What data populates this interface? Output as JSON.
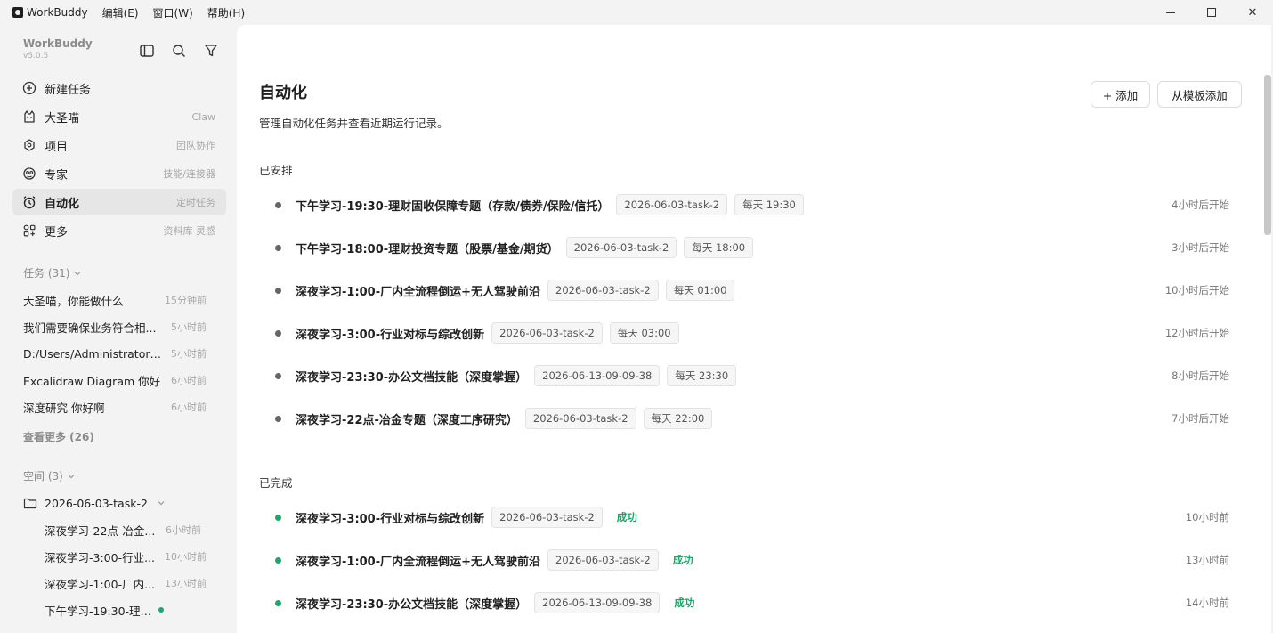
{
  "titlebar": {
    "app_name": "WorkBuddy",
    "menus": [
      "编辑(E)",
      "窗口(W)",
      "帮助(H)"
    ],
    "close_glyph": "✕"
  },
  "sidebar": {
    "brand": "WorkBuddy",
    "version": "v5.0.5",
    "nav": [
      {
        "label": "新建任务",
        "hint": "",
        "icon": "plus-circle-icon"
      },
      {
        "label": "大圣喵",
        "hint": "Claw",
        "icon": "cat-icon"
      },
      {
        "label": "项目",
        "hint": "团队协作",
        "icon": "project-icon"
      },
      {
        "label": "专家",
        "hint": "技能/连接器",
        "icon": "expert-icon"
      },
      {
        "label": "自动化",
        "hint": "定时任务",
        "icon": "alarm-clock-icon",
        "active": true
      },
      {
        "label": "更多",
        "hint": "资料库 灵感",
        "icon": "grid-icon"
      }
    ],
    "tasks_header": "任务 (31)",
    "tasks": [
      {
        "title": "大圣喵，你能做什么",
        "time": "15分钟前"
      },
      {
        "title": "我们需要确保业务符合相...",
        "time": "5小时前"
      },
      {
        "title": "D:/Users/Administrator/...",
        "time": "5小时前"
      },
      {
        "title": "Excalidraw Diagram 你好",
        "time": "6小时前"
      },
      {
        "title": "深度研究 你好啊",
        "time": "6小时前"
      }
    ],
    "see_more": "查看更多 (26)",
    "spaces_header": "空间 (3)",
    "folder": "2026-06-03-task-2",
    "workspace_items": [
      {
        "title": "深夜学习-22点-冶金...",
        "time": "6小时前"
      },
      {
        "title": "深夜学习-3:00-行业...",
        "time": "10小时前"
      },
      {
        "title": "深夜学习-1:00-厂内...",
        "time": "13小时前"
      },
      {
        "title": "下午学习-19:30-理财...",
        "time": "",
        "running": true
      }
    ]
  },
  "main": {
    "title": "自动化",
    "subtitle": "管理自动化任务并查看近期运行记录。",
    "add_button": "+ 添加",
    "template_button": "从模板添加",
    "scheduled_label": "已安排",
    "scheduled": [
      {
        "title": "下午学习-19:30-理财固收保障专题（存款/债券/保险/信托）",
        "tag": "2026-06-03-task-2",
        "schedule": "每天 19:30",
        "next": "4小时后开始"
      },
      {
        "title": "下午学习-18:00-理财投资专题（股票/基金/期货）",
        "tag": "2026-06-03-task-2",
        "schedule": "每天 18:00",
        "next": "3小时后开始"
      },
      {
        "title": "深夜学习-1:00-厂内全流程倒运+无人驾驶前沿",
        "tag": "2026-06-03-task-2",
        "schedule": "每天 01:00",
        "next": "10小时后开始"
      },
      {
        "title": "深夜学习-3:00-行业对标与综改创新",
        "tag": "2026-06-03-task-2",
        "schedule": "每天 03:00",
        "next": "12小时后开始"
      },
      {
        "title": "深夜学习-23:30-办公文档技能（深度掌握）",
        "tag": "2026-06-13-09-09-38",
        "schedule": "每天 23:30",
        "next": "8小时后开始"
      },
      {
        "title": "深夜学习-22点-冶金专题（深度工序研究）",
        "tag": "2026-06-03-task-2",
        "schedule": "每天 22:00",
        "next": "7小时后开始"
      }
    ],
    "completed_label": "已完成",
    "completed": [
      {
        "title": "深夜学习-3:00-行业对标与综改创新",
        "tag": "2026-06-03-task-2",
        "status": "成功",
        "ago": "10小时前"
      },
      {
        "title": "深夜学习-1:00-厂内全流程倒运+无人驾驶前沿",
        "tag": "2026-06-03-task-2",
        "status": "成功",
        "ago": "13小时前"
      },
      {
        "title": "深夜学习-23:30-办公文档技能（深度掌握）",
        "tag": "2026-06-13-09-09-38",
        "status": "成功",
        "ago": "14小时前"
      }
    ]
  },
  "colors": {
    "success": "#1aa86a",
    "active_nav_bg": "#e6e6e6",
    "sidebar_bg": "#f3f3f3"
  }
}
